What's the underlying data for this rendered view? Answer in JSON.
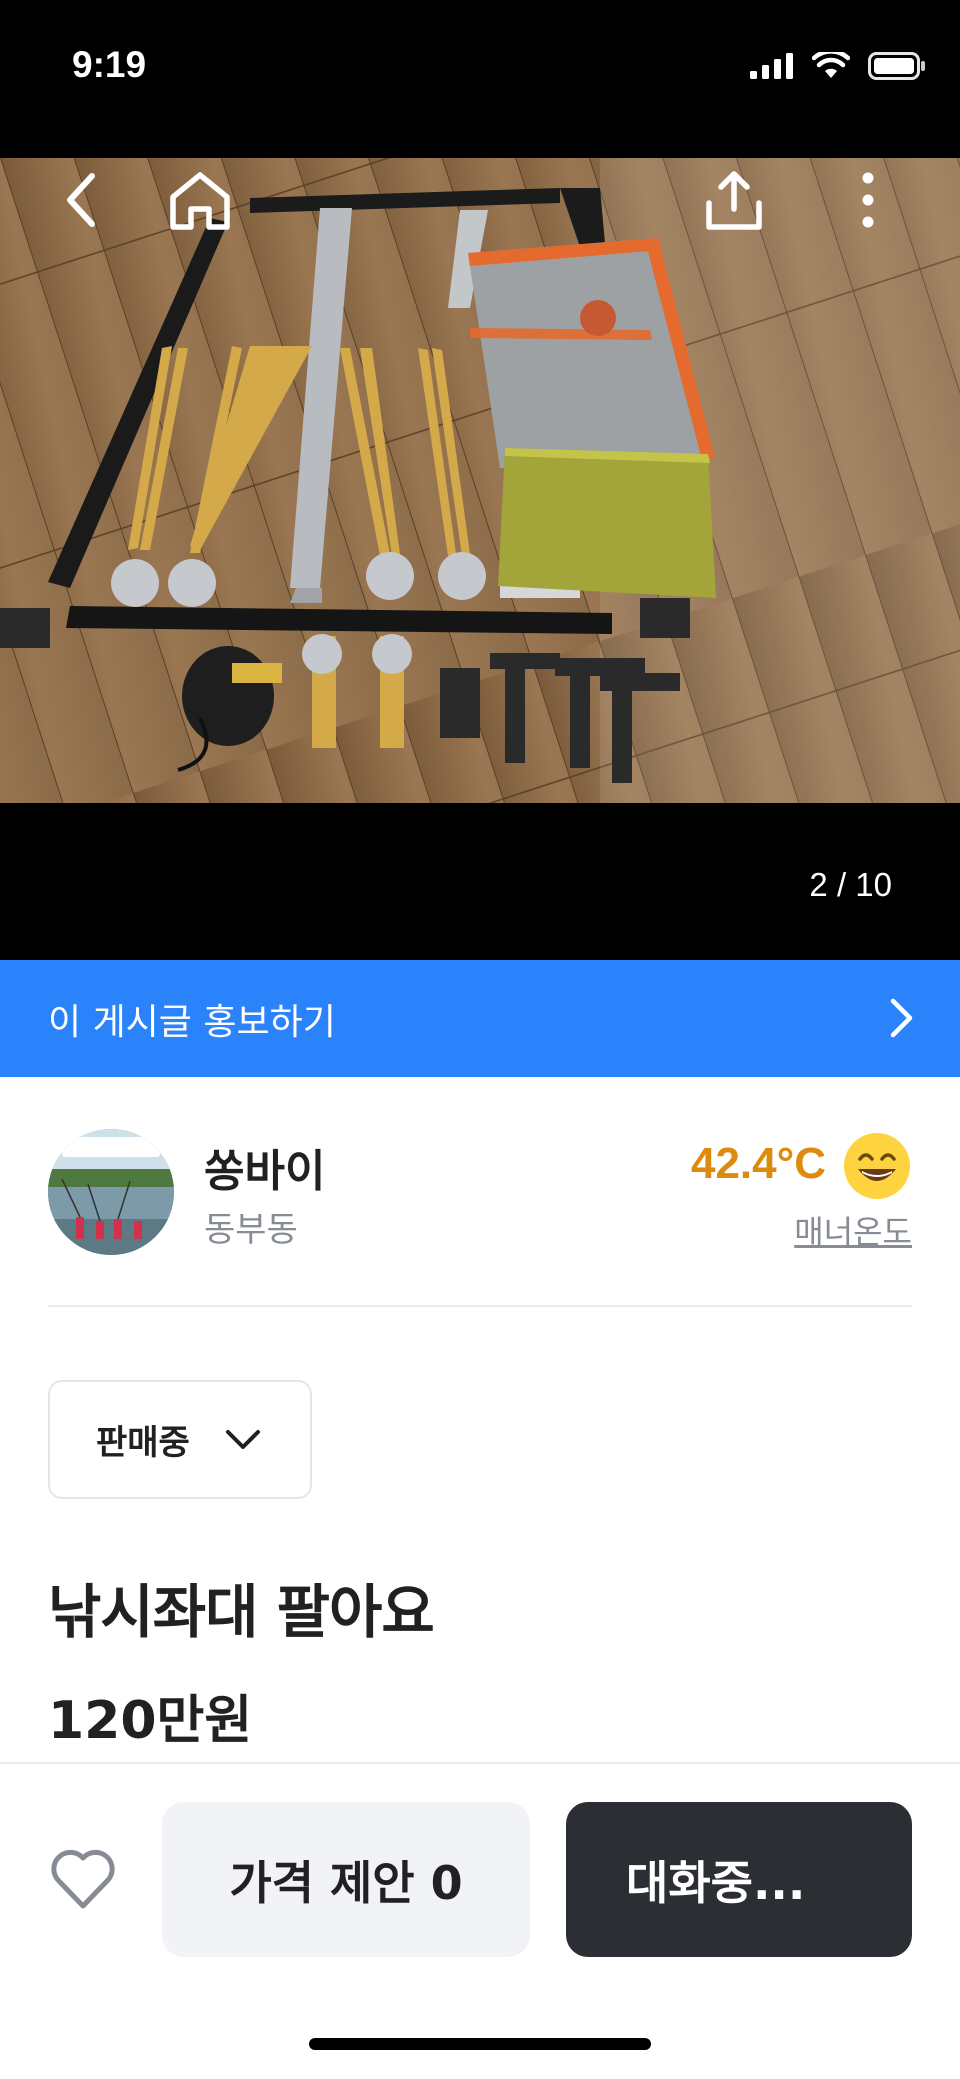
{
  "status_bar": {
    "time": "9:19"
  },
  "photo": {
    "counter": "2 / 10"
  },
  "promote": {
    "label": "이 게시글 홍보하기"
  },
  "seller": {
    "name": "쏭바이",
    "location": "동부동",
    "temperature": "42.4°C",
    "manner_label": "매너온도"
  },
  "listing": {
    "status": "판매중",
    "title": "낚시좌대 팔아요",
    "price": "120만원"
  },
  "bottom": {
    "offer_label": "가격 제안 0",
    "chat_label": "대화중..."
  },
  "colors": {
    "accent_blue": "#2a83fb",
    "temperature": "#de8a0d",
    "chat_button": "#2b2e33"
  },
  "icons": [
    "back-icon",
    "home-icon",
    "share-icon",
    "more-icon",
    "chevron-right-icon",
    "chevron-down-icon",
    "heart-icon",
    "smile-emoji-icon"
  ]
}
